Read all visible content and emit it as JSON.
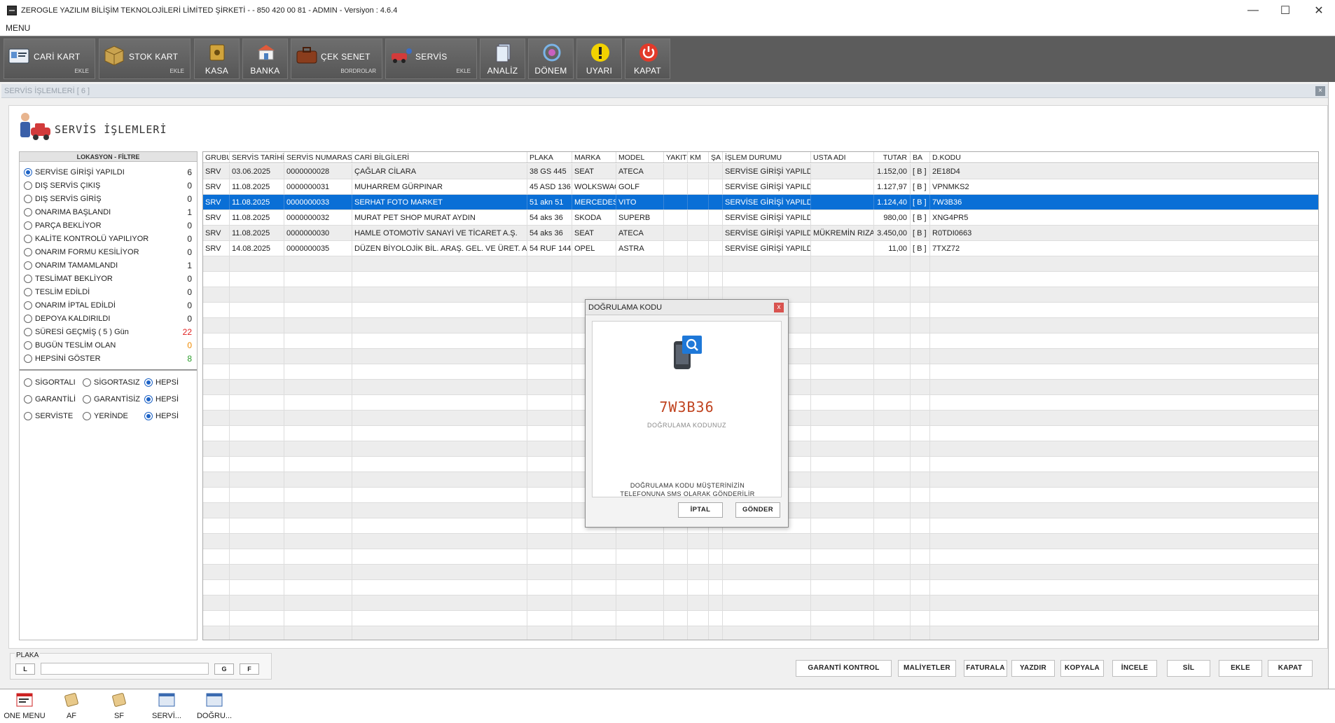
{
  "window": {
    "title": "ZEROGLE YAZILIM BİLİŞİM TEKNOLOJİLERİ LİMİTED ŞİRKETİ -  - 850 420 00 81 - ADMIN -  Versiyon : 4.6.4",
    "minimize": "—",
    "maximize": "☐",
    "close": "✕"
  },
  "menu": {
    "label": "MENU"
  },
  "toolbar": {
    "cari_kart": {
      "label": "CARİ KART",
      "sub": "EKLE"
    },
    "stok_kart": {
      "label": "STOK KART",
      "sub": "EKLE"
    },
    "kasa": {
      "label": "KASA"
    },
    "banka": {
      "label": "BANKA"
    },
    "cek_senet": {
      "label": "ÇEK SENET",
      "sub": "BORDROLAR"
    },
    "servis": {
      "label": "SERVİS",
      "sub": "EKLE"
    },
    "analiz": {
      "label": "ANALİZ"
    },
    "donem": {
      "label": "DÖNEM"
    },
    "uyari": {
      "label": "UYARI"
    },
    "kapat": {
      "label": "KAPAT"
    }
  },
  "panel": {
    "tab_title": "SERVİS İŞLEMLERİ [ 6 ]",
    "close": "×",
    "page_title": "SERVİS İŞLEMLERİ"
  },
  "filter": {
    "header": "LOKASYON - FİLTRE",
    "items": [
      {
        "label": "SERVİSE GİRİŞİ YAPILDI",
        "count": "6",
        "selected": true,
        "color": "#222222"
      },
      {
        "label": "DIŞ SERVİS ÇIKIŞ",
        "count": "0",
        "selected": false,
        "color": "#222222"
      },
      {
        "label": "DIŞ SERVİS GİRİŞ",
        "count": "0",
        "selected": false,
        "color": "#222222"
      },
      {
        "label": "ONARIMA BAŞLANDI",
        "count": "1",
        "selected": false,
        "color": "#222222"
      },
      {
        "label": "PARÇA BEKLİYOR",
        "count": "0",
        "selected": false,
        "color": "#222222"
      },
      {
        "label": "KALİTE KONTROLÜ YAPILIYOR",
        "count": "0",
        "selected": false,
        "color": "#222222"
      },
      {
        "label": "ONARIM FORMU KESİLİYOR",
        "count": "0",
        "selected": false,
        "color": "#222222"
      },
      {
        "label": "ONARIM TAMAMLANDI",
        "count": "1",
        "selected": false,
        "color": "#222222"
      },
      {
        "label": "TESLİMAT BEKLİYOR",
        "count": "0",
        "selected": false,
        "color": "#222222"
      },
      {
        "label": "TESLİM EDİLDİ",
        "count": "0",
        "selected": false,
        "color": "#222222"
      },
      {
        "label": "ONARIM İPTAL EDİLDİ",
        "count": "0",
        "selected": false,
        "color": "#222222"
      },
      {
        "label": "DEPOYA KALDIRILDI",
        "count": "0",
        "selected": false,
        "color": "#222222"
      },
      {
        "label": "SÜRESİ GEÇMİŞ ( 5 ) Gün",
        "count": "22",
        "selected": false,
        "color": "#e02020"
      },
      {
        "label": "BUGÜN TESLİM OLAN",
        "count": "0",
        "selected": false,
        "color": "#f08a00"
      },
      {
        "label": "HEPSİNİ GÖSTER",
        "count": "8",
        "selected": false,
        "color": "#2a9d2a"
      }
    ],
    "options": [
      [
        "SİGORTALI",
        "SİGORTASIZ",
        "HEPSİ"
      ],
      [
        "GARANTİLİ",
        "GARANTİSİZ",
        "HEPSİ"
      ],
      [
        "SERVİSTE",
        "YERİNDE",
        "HEPSİ"
      ]
    ]
  },
  "grid": {
    "columns": [
      "GRUBU",
      "SERVİS TARİHİ",
      "SERVİS NUMARASI",
      "CARİ BİLGİLERİ",
      "PLAKA",
      "MARKA",
      "MODEL",
      "YAKIT",
      "KM",
      "ŞA",
      "İŞLEM DURUMU",
      "USTA ADI",
      "TUTAR",
      "BA",
      "D.KODU"
    ],
    "rows": [
      [
        "SRV",
        "03.06.2025",
        "0000000028",
        "ÇAĞLAR CİLARA",
        "38 GS 445",
        "SEAT",
        "ATECA",
        "",
        "",
        "",
        "SERVİSE GİRİŞİ YAPILDI",
        "",
        "1.152,00",
        "[ B ]",
        "2E18D4"
      ],
      [
        "SRV",
        "11.08.2025",
        "0000000031",
        "MUHARREM GÜRPINAR",
        "45 ASD 136",
        "WOLKSWAGEN",
        "GOLF",
        "",
        "",
        "",
        "SERVİSE GİRİŞİ YAPILDI",
        "",
        "1.127,97",
        "[ B ]",
        "VPNMKS2"
      ],
      [
        "SRV",
        "11.08.2025",
        "0000000033",
        "SERHAT FOTO MARKET",
        "51 akn 51",
        "MERCEDES",
        "VITO",
        "",
        "",
        "",
        "SERVİSE GİRİŞİ YAPILDI",
        "",
        "1.124,40",
        "[ B ]",
        "7W3B36"
      ],
      [
        "SRV",
        "11.08.2025",
        "0000000032",
        "MURAT PET SHOP MURAT AYDIN",
        "54 aks 36",
        "SKODA",
        "SUPERB",
        "",
        "",
        "",
        "SERVİSE GİRİŞİ YAPILDI",
        "",
        "980,00",
        "[ B ]",
        "XNG4PR5"
      ],
      [
        "SRV",
        "11.08.2025",
        "0000000030",
        "HAMLE OTOMOTİV SANAYİ VE TİCARET A.Ş.",
        "54 aks 36",
        "SEAT",
        "ATECA",
        "",
        "",
        "",
        "SERVİSE GİRİŞİ YAPILDI",
        "MÜKREMİN RIZA",
        "3.450,00",
        "[ B ]",
        "R0TDI0663"
      ],
      [
        "SRV",
        "14.08.2025",
        "0000000035",
        "DÜZEN BİYOLOJİK BİL. ARAŞ. GEL. VE ÜRET. A.Ş.",
        "54 RUF 144",
        "OPEL",
        "ASTRA",
        "",
        "",
        "",
        "SERVİSE GİRİŞİ YAPILDI",
        "",
        "11,00",
        "[ B ]",
        "7TXZ72"
      ]
    ],
    "selected_row": 2
  },
  "dialog": {
    "title": "DOĞRULAMA KODU",
    "close": "x",
    "code": "7W3B36",
    "code_caption": "DOĞRULAMA KODUNUZ",
    "message_line1": "DOĞRULAMA KODU MÜŞTERİNİZİN",
    "message_line2": "TELEFONUNA SMS OLARAK GÖNDERİLİR",
    "cancel": "İPTAL",
    "send": "GÖNDER",
    "code_color": "#c0431f"
  },
  "bottom": {
    "plaka_label": "PLAKA",
    "l_button": "L",
    "plaka_value": "",
    "g_button": "G",
    "f_button": "F",
    "actions": [
      "GARANTİ KONTROL",
      "MALİYETLER",
      "FATURALA",
      "YAZDIR",
      "KOPYALA",
      "İNCELE",
      "SİL",
      "EKLE",
      "KAPAT"
    ]
  },
  "taskbar": [
    "ONE MENU",
    "AF",
    "SF",
    "SERVİ...",
    "DOĞRU..."
  ],
  "colors": {
    "accent": "#0a6fd6",
    "toolbar": "#5c5c5c",
    "radio": "#1d63c6"
  }
}
